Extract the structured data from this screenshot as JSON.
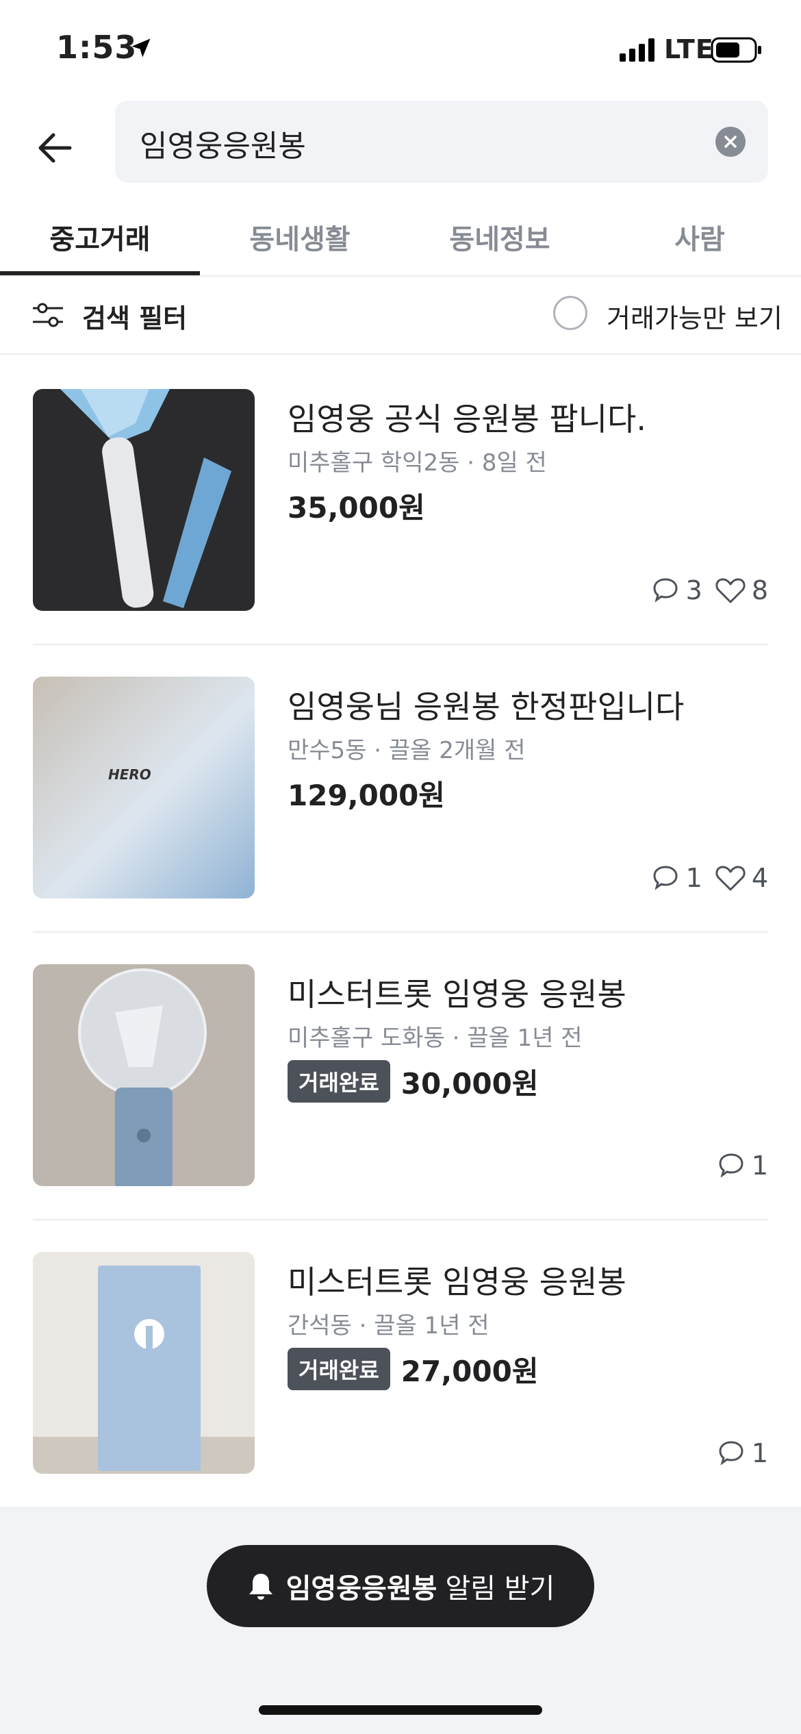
{
  "status_bar": {
    "time": "1:53",
    "network": "LTE"
  },
  "search": {
    "query": "임영웅응원봉"
  },
  "tabs": [
    {
      "label": "중고거래",
      "active": true
    },
    {
      "label": "동네생활",
      "active": false
    },
    {
      "label": "동네정보",
      "active": false
    },
    {
      "label": "사람",
      "active": false
    }
  ],
  "filter": {
    "label": "검색 필터",
    "available_only_label": "거래가능만 보기"
  },
  "listings": [
    {
      "title": "임영웅 공식 응원봉 팝니다.",
      "meta": "미추홀구 학익2동 · 8일 전",
      "badge": "",
      "price": "35,000원",
      "comments": "3",
      "likes": "8"
    },
    {
      "title": "임영웅님 응원봉 한정판입니다",
      "meta": "만수5동 · 끌올 2개월 전",
      "badge": "",
      "price": "129,000원",
      "comments": "1",
      "likes": "4"
    },
    {
      "title": "미스터트롯 임영웅 응원봉",
      "meta": "미추홀구 도화동 · 끌올 1년 전",
      "badge": "거래완료",
      "price": "30,000원",
      "comments": "1",
      "likes": ""
    },
    {
      "title": "미스터트롯 임영웅 응원봉",
      "meta": "간석동 · 끌올 1년 전",
      "badge": "거래완료",
      "price": "27,000원",
      "comments": "1",
      "likes": ""
    }
  ],
  "alert": {
    "keyword": "임영웅응원봉",
    "suffix": "알림 받기"
  },
  "colors": {
    "text": "#212124",
    "muted": "#868b94",
    "badge_bg": "#4d5159",
    "alert_bg": "#212124"
  }
}
